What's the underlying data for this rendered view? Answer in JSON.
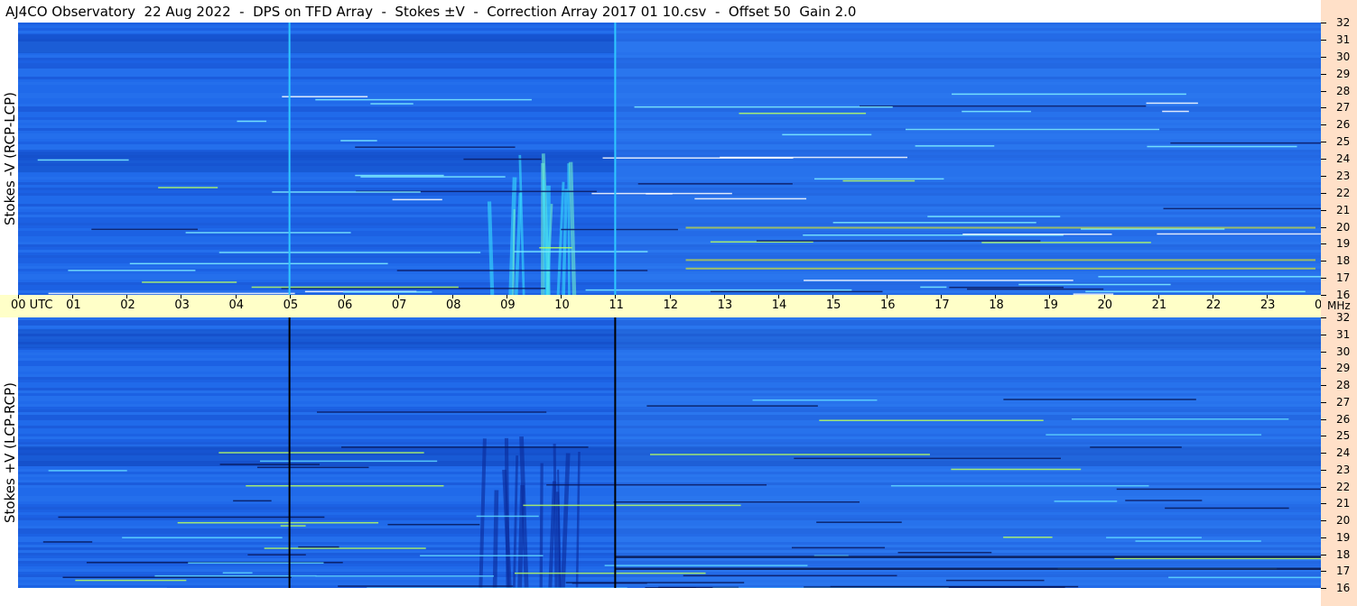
{
  "title": "AJ4CO Observatory  22 Aug 2022  -  DPS on TFD Array  -  Stokes ±V  -  Correction Array 2017 01 10.csv  -  Offset 50  Gain 2.0",
  "colors": {
    "background": "#1e64e6",
    "time_axis": "#ffffc8",
    "freq_axis": "#ffe0c8",
    "hot": "#ffff00"
  },
  "chart_data": [
    {
      "type": "heatmap",
      "title": "AJ4CO Observatory  22 Aug 2022  -  DPS on TFD Array  -  Stokes ±V  -  Correction Array 2017 01 10.csv  -  Offset 50  Gain 2.0",
      "panel": "top",
      "ylabel": "Stokes -V (RCP-LCP)",
      "xlabel": "UTC",
      "x_ticks": [
        "00 UTC",
        "01",
        "02",
        "03",
        "04",
        "05",
        "06",
        "07",
        "08",
        "09",
        "10",
        "11",
        "12",
        "13",
        "14",
        "15",
        "16",
        "17",
        "18",
        "19",
        "20",
        "21",
        "22",
        "23",
        "00"
      ],
      "x_range_hours": [
        0,
        24
      ],
      "y_unit": "MHz",
      "y_ticks": [
        32,
        31,
        30,
        29,
        28,
        27,
        26,
        25,
        24,
        23,
        22,
        21,
        20,
        19,
        18,
        17,
        16
      ],
      "y_range_mhz": [
        16,
        32
      ],
      "time_markers_hours": [
        5,
        11
      ],
      "time_marker_color": "#2fc8ff",
      "burst_window_hours": [
        8.5,
        10.3
      ],
      "grid": false
    },
    {
      "type": "heatmap",
      "panel": "bottom",
      "ylabel": "Stokes +V (LCP-RCP)",
      "xlabel": "UTC",
      "x_ticks": [
        "00 UTC",
        "01",
        "02",
        "03",
        "04",
        "05",
        "06",
        "07",
        "08",
        "09",
        "10",
        "11",
        "12",
        "13",
        "14",
        "15",
        "16",
        "17",
        "18",
        "19",
        "20",
        "21",
        "22",
        "23",
        "00"
      ],
      "x_range_hours": [
        0,
        24
      ],
      "y_unit": "MHz",
      "y_ticks": [
        32,
        31,
        30,
        29,
        28,
        27,
        26,
        25,
        24,
        23,
        22,
        21,
        20,
        19,
        18,
        17,
        16
      ],
      "y_range_mhz": [
        16,
        32
      ],
      "time_markers_hours": [
        5,
        11
      ],
      "time_marker_color": "#000000",
      "burst_window_hours": [
        8.5,
        10.3
      ],
      "grid": false
    }
  ],
  "mhz_unit": "MHz"
}
